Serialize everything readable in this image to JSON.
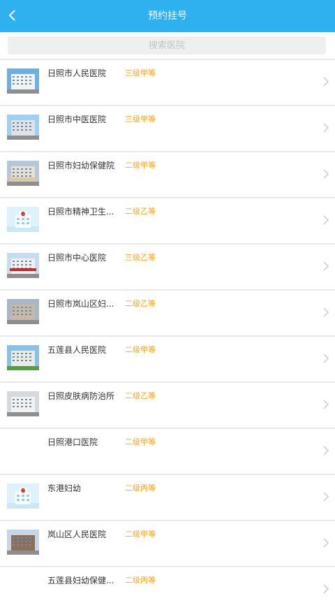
{
  "header": {
    "title": "预约挂号",
    "back_icon": "chevron-left-icon"
  },
  "search": {
    "placeholder": "搜索医院"
  },
  "hospitals": [
    {
      "name": "日照市人民医院",
      "level": "三级甲等",
      "thumb": "building-blue"
    },
    {
      "name": "日照市中医医院",
      "level": "三级甲等",
      "thumb": "building-sky"
    },
    {
      "name": "日照市妇幼保健院",
      "level": "二级甲等",
      "thumb": "building-sign"
    },
    {
      "name": "日照市精神卫生...",
      "level": "二级乙等",
      "thumb": "hospital-placeholder"
    },
    {
      "name": "日照市中心医院",
      "level": "三级乙等",
      "thumb": "building-red-sign"
    },
    {
      "name": "日照市岚山区妇...",
      "level": "二级乙等",
      "thumb": "building-street"
    },
    {
      "name": "五莲县人民医院",
      "level": "二级甲等",
      "thumb": "building-campus"
    },
    {
      "name": "日照皮肤病防治所",
      "level": "二级乙等",
      "thumb": "building-gray"
    },
    {
      "name": "日照港口医院",
      "level": "二级甲等",
      "thumb": "none"
    },
    {
      "name": "东港妇幼",
      "level": "二级丙等",
      "thumb": "hospital-placeholder"
    },
    {
      "name": "岚山区人民医院",
      "level": "二级甲等",
      "thumb": "building-brown"
    },
    {
      "name": "五莲县妇幼保健...",
      "level": "二级丙等",
      "thumb": "none"
    }
  ],
  "colors": {
    "header": "#2fb1f0",
    "level": "#f5a623",
    "text": "#333333"
  }
}
